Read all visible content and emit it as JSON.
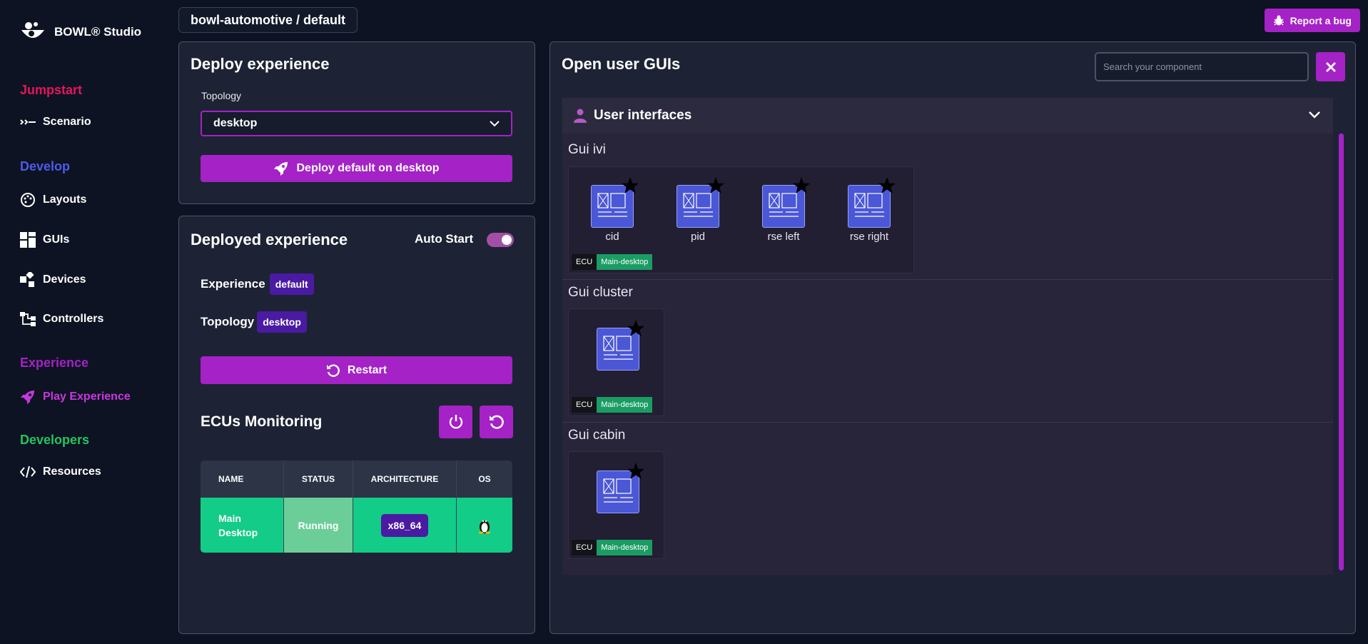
{
  "app": {
    "name": "BOWL® Studio"
  },
  "sidebar": {
    "sections": [
      {
        "title": "Jumpstart",
        "color": "#e6155b"
      },
      {
        "title": "Develop",
        "color": "#4b5ce8"
      },
      {
        "title": "Experience",
        "color": "#a422c6"
      },
      {
        "title": "Developers",
        "color": "#22c55e"
      }
    ],
    "items": [
      {
        "label": "Scenario",
        "icon": "scenario-icon"
      },
      {
        "label": "Layouts",
        "icon": "palette-icon"
      },
      {
        "label": "GUIs",
        "icon": "grid-icon"
      },
      {
        "label": "Devices",
        "icon": "devices-icon"
      },
      {
        "label": "Controllers",
        "icon": "nodes-icon"
      },
      {
        "label": "Play Experience",
        "icon": "rocket-icon",
        "active_color": "#c837e0"
      },
      {
        "label": "Resources",
        "icon": "code-icon"
      }
    ]
  },
  "header": {
    "breadcrumb": "bowl-automotive / default",
    "report_bug": "Report a bug"
  },
  "deploy": {
    "title": "Deploy experience",
    "topology_label": "Topology",
    "topology_value": "desktop",
    "button": "Deploy default on desktop"
  },
  "deployed": {
    "title": "Deployed experience",
    "auto_start_label": "Auto Start",
    "auto_start_on": true,
    "experience_label": "Experience",
    "experience_value": "default",
    "topology_label": "Topology",
    "topology_value": "desktop",
    "restart": "Restart",
    "ecus_title": "ECUs Monitoring",
    "table": {
      "headers": [
        "NAME",
        "STATUS",
        "ARCHITECTURE",
        "OS"
      ],
      "rows": [
        {
          "name": "Main Desktop",
          "status": "Running",
          "architecture": "x86_64",
          "os": "linux-icon"
        }
      ]
    }
  },
  "open_guis": {
    "title": "Open user GUIs",
    "search_placeholder": "Search your component",
    "section_title": "User interfaces",
    "groups": [
      {
        "title": "Gui ivi",
        "items": [
          "cid",
          "pid",
          "rse left",
          "rse right"
        ],
        "ecu_key": "ECU",
        "ecu_value": "Main-desktop"
      },
      {
        "title": "Gui cluster",
        "items": [
          ""
        ],
        "ecu_key": "ECU",
        "ecu_value": "Main-desktop"
      },
      {
        "title": "Gui cabin",
        "items": [
          ""
        ],
        "ecu_key": "ECU",
        "ecu_value": "Main-desktop"
      }
    ]
  }
}
